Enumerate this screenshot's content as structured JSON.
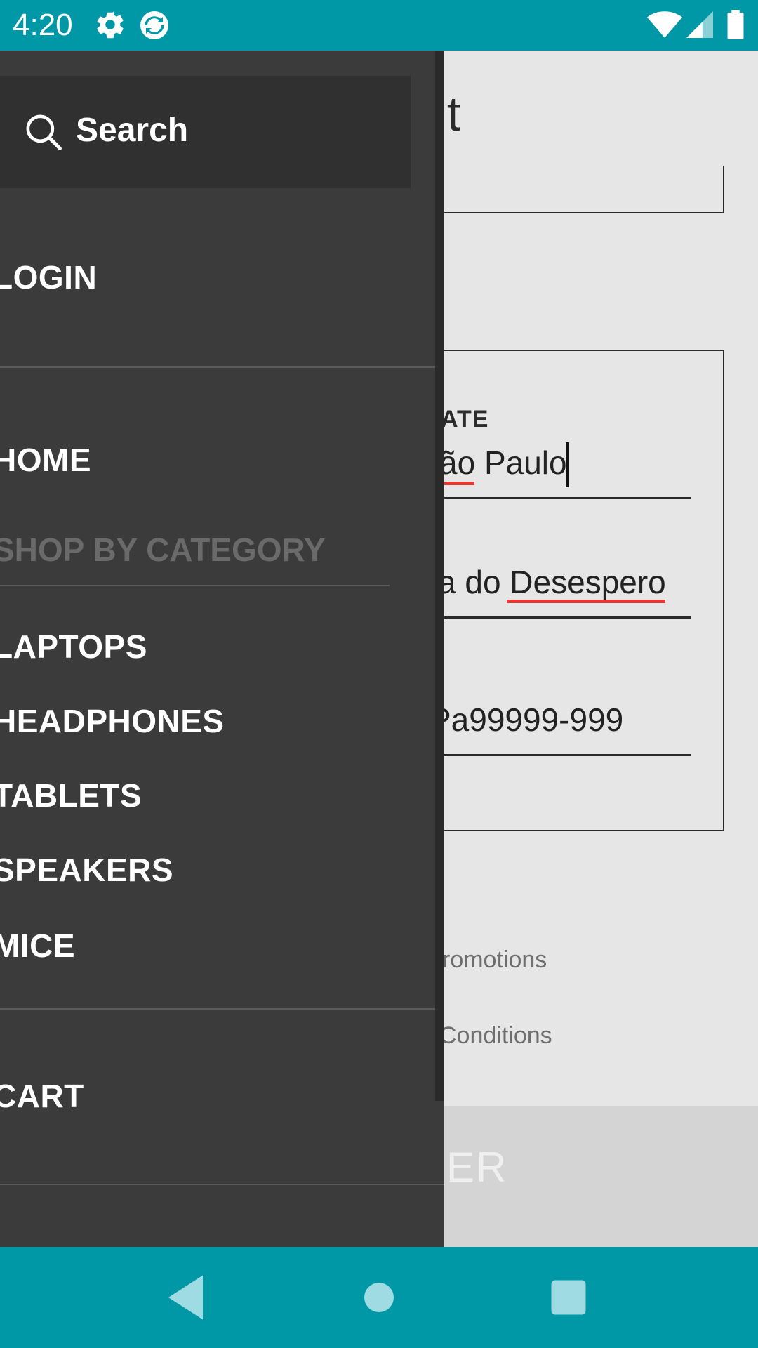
{
  "status_bar": {
    "time": "4:20"
  },
  "drawer": {
    "search": {
      "label": "Search"
    },
    "login_label": "LOGIN",
    "home_label": "HOME",
    "section_header": "SHOP BY CATEGORY",
    "categories": [
      {
        "label": "LAPTOPS"
      },
      {
        "label": "HEADPHONES"
      },
      {
        "label": "TABLETS"
      },
      {
        "label": "SPEAKERS"
      },
      {
        "label": "MICE"
      }
    ],
    "cart_label": "CART"
  },
  "background": {
    "title_partial": "ount",
    "state_label_partial": "ATE",
    "state_value_partial": "ão Paulo",
    "street_value_partial": "a do Desespero",
    "zip_value_partial": "Pa99999-999",
    "promotions_partial": "romotions",
    "conditions_partial": "Conditions",
    "register_partial": "ER"
  },
  "colors": {
    "accent": "#0097a7",
    "drawer_bg": "#3b3b3b",
    "search_bg": "#303030",
    "error_underline": "#e53935"
  }
}
